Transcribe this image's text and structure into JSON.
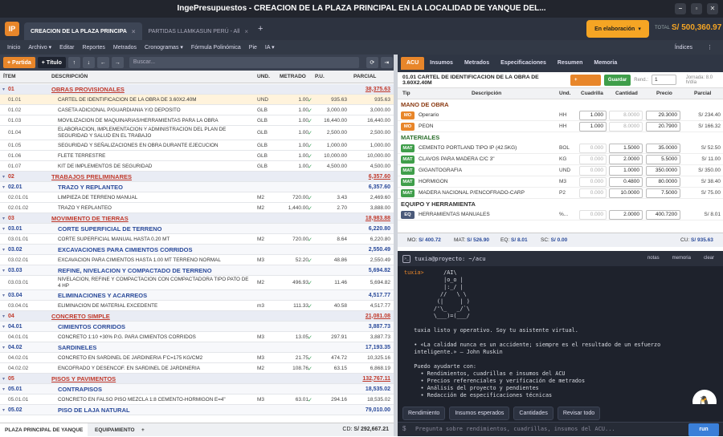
{
  "window": {
    "title": "IngePresupuestos  -  CREACION DE LA PLAZA PRINCIPAL EN LA LOCALIDAD DE YANQUE DEL...",
    "min": "–",
    "max": "▫",
    "close": "✕"
  },
  "app_logo": "IP",
  "doc_tabs": [
    {
      "label": "CREACION DE LA PLAZA PRINCIPA",
      "close": "×"
    },
    {
      "label": "PARTIDAS LLAMKASUN PERÚ - All",
      "close": "×"
    }
  ],
  "add_tab": "+",
  "status": {
    "label": "En elaboración",
    "chevron": "▾"
  },
  "total": {
    "label": "TOTAL",
    "value": "S/ 500,360.97"
  },
  "menu": [
    "Inicio",
    "Archivo ▾",
    "Editar",
    "Reportes",
    "Metrados",
    "Cronogramas ▾",
    "Fórmula Polinómica",
    "Pie",
    "IA ▾"
  ],
  "menu_right": {
    "indices": "Índices",
    "more": "⋮"
  },
  "toolbar": {
    "partida": "+ Partida",
    "titulo": "+ Título",
    "up": "↑",
    "down": "↓",
    "left": "←",
    "right": "→",
    "search_placeholder": "Buscar...",
    "refresh": "⟳",
    "expand": "⇥"
  },
  "table": {
    "headers": {
      "item": "ÍTEM",
      "desc": "DESCRIPCIÓN",
      "unit": "UND.",
      "met": "METRADO",
      "pu": "P.U.",
      "par": "PARCIAL"
    },
    "rows": [
      {
        "k": "chap",
        "code": "01",
        "desc": "OBRAS PROVISIONALES",
        "par": "38,375.63"
      },
      {
        "k": "item hl",
        "code": "01.01",
        "desc": "CARTEL DE IDENTIFICACION DE LA OBRA DE 3.60X2.40M",
        "unit": "UND",
        "met": "1.00",
        "pu": "935.63",
        "par": "935.63"
      },
      {
        "k": "item",
        "code": "01.02",
        "desc": "CASETA ADICIONAL P/GUARDIANIA Y/O DEPOSITO",
        "unit": "GLB",
        "met": "1.00",
        "pu": "3,000.00",
        "par": "3,000.00"
      },
      {
        "k": "item",
        "code": "01.03",
        "desc": "MOVILIZACION DE MAQUINARIAS/HERRAMIENTAS PARA LA OBRA",
        "unit": "GLB",
        "met": "1.00",
        "pu": "16,440.00",
        "par": "16,440.00"
      },
      {
        "k": "item tall",
        "code": "01.04",
        "desc": "ELABORACION, IMPLEMENTACION Y ADMINISTRACION DEL PLAN DE SEGURIDAD Y SALUD EN EL TRABAJO",
        "unit": "GLB",
        "met": "1.00",
        "pu": "2,500.00",
        "par": "2,500.00"
      },
      {
        "k": "item",
        "code": "01.05",
        "desc": "SEGURIDAD Y SEÑALIZACIONES EN OBRA DURANTE EJECUCION",
        "unit": "GLB",
        "met": "1.00",
        "pu": "1,000.00",
        "par": "1,000.00"
      },
      {
        "k": "item",
        "code": "01.06",
        "desc": "FLETE TERRESTRE",
        "unit": "GLB",
        "met": "1.00",
        "pu": "10,000.00",
        "par": "10,000.00"
      },
      {
        "k": "item",
        "code": "01.07",
        "desc": "KIT DE IMPLEMENTOS DE SEGURIDAD",
        "unit": "GLB",
        "met": "1.00",
        "pu": "4,500.00",
        "par": "4,500.00"
      },
      {
        "k": "chap",
        "code": "02",
        "desc": "TRABAJOS PRELIMINARES",
        "par": "6,357.60"
      },
      {
        "k": "sub",
        "code": "02.01",
        "desc": "TRAZO Y REPLANTEO",
        "par": "6,357.60"
      },
      {
        "k": "item",
        "code": "02.01.01",
        "desc": "LIMPIEZA DE TERRENO MANUAL",
        "unit": "M2",
        "met": "720.00",
        "pu": "3.43",
        "par": "2,469.60"
      },
      {
        "k": "item",
        "code": "02.01.02",
        "desc": "TRAZO Y REPLANTEO",
        "unit": "M2",
        "met": "1,440.00",
        "pu": "2.70",
        "par": "3,888.00"
      },
      {
        "k": "chap",
        "code": "03",
        "desc": "MOVIMIENTO DE TIERRAS",
        "par": "18,983.88"
      },
      {
        "k": "sub",
        "code": "03.01",
        "desc": "CORTE SUPERFICIAL DE TERRENO",
        "par": "6,220.80"
      },
      {
        "k": "item",
        "code": "03.01.01",
        "desc": "CORTE SUPERFICIAL MANUAL HASTA 0.20 MT",
        "unit": "M2",
        "met": "720.00",
        "pu": "8.64",
        "par": "6,220.80"
      },
      {
        "k": "sub",
        "code": "03.02",
        "desc": "EXCAVACIONES PARA CIMIENTOS CORRIDOS",
        "par": "2,550.49"
      },
      {
        "k": "item",
        "code": "03.02.01",
        "desc": "EXCAVACION PARA CIMIENTOS HASTA 1.00 MT TERRENO NORMAL",
        "unit": "M3",
        "met": "52.20",
        "pu": "48.86",
        "par": "2,550.49"
      },
      {
        "k": "sub",
        "code": "03.03",
        "desc": "REFINE, NIVELACION Y COMPACTADO DE TERRENO",
        "par": "5,694.82"
      },
      {
        "k": "item tall",
        "code": "03.03.01",
        "desc": "NIVELACION, REFINE Y COMPACTACION CON COMPACTADORA TIPO PATO DE 4 HP",
        "unit": "M2",
        "met": "496.93",
        "pu": "11.46",
        "par": "5,694.82"
      },
      {
        "k": "sub",
        "code": "03.04",
        "desc": "ELIMINACIONES Y ACARREOS",
        "par": "4,517.77"
      },
      {
        "k": "item",
        "code": "03.04.01",
        "desc": "ELIMINACION DE MATERIAL EXCEDENTE",
        "unit": "m3",
        "met": "111.33",
        "pu": "40.58",
        "par": "4,517.77"
      },
      {
        "k": "chap",
        "code": "04",
        "desc": "CONCRETO SIMPLE",
        "par": "21,081.08"
      },
      {
        "k": "sub",
        "code": "04.01",
        "desc": "CIMIENTOS CORRIDOS",
        "par": "3,887.73"
      },
      {
        "k": "item",
        "code": "04.01.01",
        "desc": "CONCRETO 1:10 +30% P.G. PARA CIMIENTOS CORRIDOS",
        "unit": "M3",
        "met": "13.05",
        "pu": "297.91",
        "par": "3,887.73"
      },
      {
        "k": "sub",
        "code": "04.02",
        "desc": "SARDINELES",
        "par": "17,193.35"
      },
      {
        "k": "item",
        "code": "04.02.01",
        "desc": "CONCRETO EN SARDINEL DE JARDINERIA F'C=175 KG/CM2",
        "unit": "M3",
        "met": "21.75",
        "pu": "474.72",
        "par": "10,325.16"
      },
      {
        "k": "item",
        "code": "04.02.02",
        "desc": "ENCOFRADO Y DESENCOF. EN SARDINEL DE JARDINERIA",
        "unit": "M2",
        "met": "108.76",
        "pu": "63.15",
        "par": "6,868.19"
      },
      {
        "k": "chap",
        "code": "05",
        "desc": "PISOS Y PAVIMENTOS",
        "par": "132,767.11"
      },
      {
        "k": "sub",
        "code": "05.01",
        "desc": "CONTRAPISOS",
        "par": "18,535.02"
      },
      {
        "k": "item",
        "code": "05.01.01",
        "desc": "CONCRETO EN FALSO PISO MEZCLA 1:8 CEMENTO-HORMIGON E=4\"",
        "unit": "M3",
        "met": "63.01",
        "pu": "294.16",
        "par": "18,535.02"
      },
      {
        "k": "sub",
        "code": "05.02",
        "desc": "PISO DE LAJA NATURAL",
        "par": "79,010.00"
      }
    ]
  },
  "bottom_tabs": [
    "PLAZA PRINCIPAL DE YANQUE",
    "EQUIPAMIENTO",
    "+"
  ],
  "cd": {
    "label": "CD:",
    "value": "S/ 292,667.21"
  },
  "right_tabs": [
    "ACU",
    "Insumos",
    "Metrados",
    "Especificaciones",
    "Resumen",
    "Memoria"
  ],
  "acu": {
    "title": "01.01  CARTEL DE IDENTIFICACION DE LA OBRA DE 3.60X2.40M",
    "add_resource": "+ Recurso",
    "save": "Guardar",
    "rend_label": "Rend.:",
    "rend_value": "1",
    "jornada": "Jornada: 8.0 h/día",
    "headers": {
      "tip": "Tip",
      "desc": "Descripción",
      "und": "Und.",
      "cuad": "Cuadrilla",
      "cant": "Cantidad",
      "precio": "Precio",
      "parcial": "Parcial"
    },
    "groups": [
      {
        "name": "MANO DE OBRA",
        "cls": "mo",
        "items": [
          {
            "tag": "MO",
            "desc": "Operario",
            "und": "HH",
            "cuad": "1.000",
            "cant": "8.0000",
            "precio": "29.3000",
            "parcial": "S/ 234.40"
          },
          {
            "tag": "MO",
            "desc": "PEON",
            "und": "HH",
            "cuad": "1.000",
            "cant": "8.0000",
            "precio": "20.7900",
            "parcial": "S/ 166.32"
          }
        ]
      },
      {
        "name": "MATERIALES",
        "cls": "mat",
        "items": [
          {
            "tag": "MAT",
            "desc": "CEMENTO PORTLAND TIPO IP (42.5KG)",
            "und": "BOL",
            "cuad": "0.000",
            "cant": "1.5000",
            "precio": "35.0000",
            "parcial": "S/ 52.50"
          },
          {
            "tag": "MAT",
            "desc": "CLAVOS PARA MADERA C/C 3\"",
            "und": "KG",
            "cuad": "0.000",
            "cant": "2.0000",
            "precio": "5.5000",
            "parcial": "S/ 11.00"
          },
          {
            "tag": "MAT",
            "desc": "GIGANTOGRAFIA",
            "und": "UND",
            "cuad": "0.000",
            "cant": "1.0000",
            "precio": "350.0000",
            "parcial": "S/ 350.00"
          },
          {
            "tag": "MAT",
            "desc": "HORMIGON",
            "und": "M3",
            "cuad": "0.000",
            "cant": "0.4800",
            "precio": "80.0000",
            "parcial": "S/ 38.40"
          },
          {
            "tag": "MAT",
            "desc": "MADERA NACIONAL P/ENCOFRADO-CARP",
            "und": "P2",
            "cuad": "0.000",
            "cant": "10.0000",
            "precio": "7.5000",
            "parcial": "S/ 75.00"
          }
        ]
      },
      {
        "name": "EQUIPO Y HERRAMIENTA",
        "cls": "eq",
        "items": [
          {
            "tag": "EQ",
            "desc": "HERRAMIENTAS MANUALES",
            "und": "%...",
            "cuad": "0.000",
            "cant": "2.0000",
            "precio": "400.7200",
            "parcial": "S/ 8.01"
          }
        ]
      }
    ],
    "summary": {
      "mo_l": "MO:",
      "mo": "S/ 400.72",
      "mat_l": "MAT:",
      "mat": "S/ 526.90",
      "eq_l": "EQ:",
      "eq": "S/ 8.01",
      "sc_l": "SC:",
      "sc": "S/ 0.00",
      "cu_l": "CU:",
      "cu": "S/ 935.63"
    }
  },
  "terminal": {
    "title": "tuxia@proyecto: ~/acu",
    "btns": [
      "notas",
      "memoria",
      "clear"
    ],
    "lines": [
      [
        "tuxia>",
        "      /AI\\"
      ],
      [
        "",
        "            |o_o |"
      ],
      [
        "",
        "            |:_/ |"
      ],
      [
        "",
        "           //   \\ \\"
      ],
      [
        "",
        "          (|     | )"
      ],
      [
        "",
        "         /'\\_   _/`\\"
      ],
      [
        "",
        "         \\___)=(___/"
      ],
      [
        "",
        ""
      ],
      [
        "",
        "   tuxia listo y operativo. Soy tu asistente virtual."
      ],
      [
        "",
        ""
      ],
      [
        "",
        "   • «La calidad nunca es un accidente; siempre es el resultado de un esfuerzo"
      ],
      [
        "",
        "   inteligente.» — John Ruskin"
      ],
      [
        "",
        ""
      ],
      [
        "",
        "   Puedo ayudarte con:"
      ],
      [
        "",
        "     • Rendimientos, cuadrillas e insumos del ACU"
      ],
      [
        "",
        "     • Precios referenciales y verificación de metrados"
      ],
      [
        "",
        "     • Análisis del proyecto y pendientes"
      ],
      [
        "",
        "     • Redacción de especificaciones técnicas"
      ]
    ],
    "quick": [
      "Rendimiento",
      "Insumos esperados",
      "Cantidades",
      "Revisar todo"
    ],
    "ask_placeholder": "Pregunta sobre rendimientos, cuadrillas, insumos del ACU...",
    "run": "run"
  }
}
